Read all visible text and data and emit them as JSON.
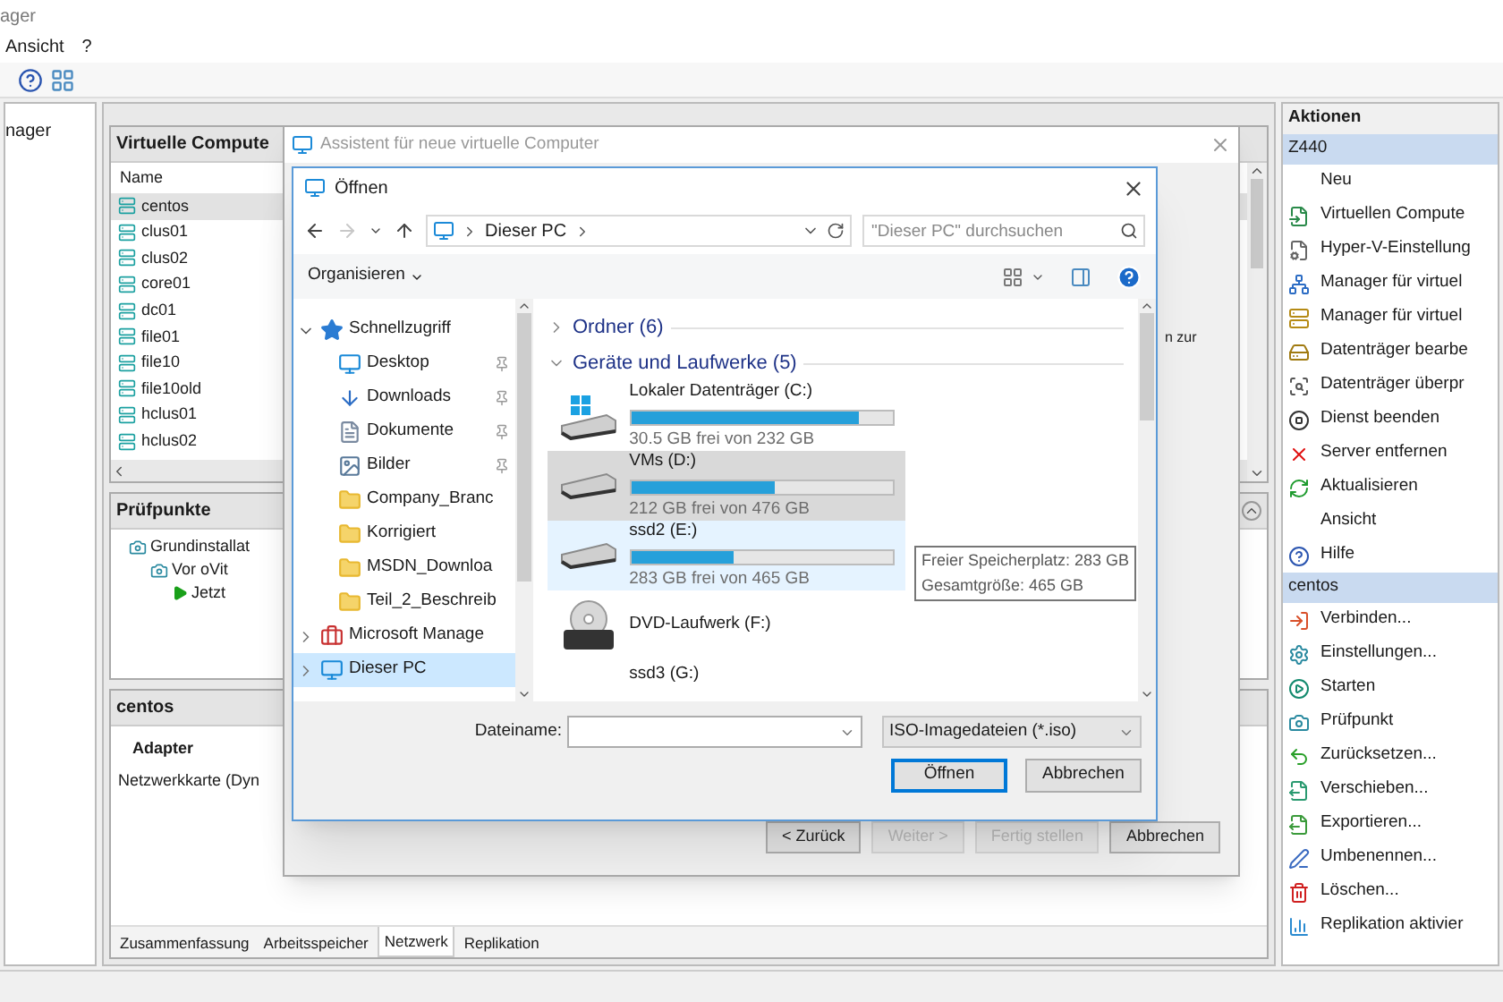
{
  "window": {
    "title": "ager"
  },
  "menu": [
    "Ansicht",
    "?"
  ],
  "left_tree": {
    "label": "nager"
  },
  "vm_panel": {
    "title": "Virtuelle Compute",
    "column": "Name",
    "rows": [
      {
        "name": "centos",
        "selected": true
      },
      {
        "name": "clus01",
        "selected": false
      },
      {
        "name": "clus02",
        "selected": false
      },
      {
        "name": "core01",
        "selected": false
      },
      {
        "name": "dc01",
        "selected": false
      },
      {
        "name": "file01",
        "selected": false
      },
      {
        "name": "file10",
        "selected": false
      },
      {
        "name": "file10old",
        "selected": false
      },
      {
        "name": "hclus01",
        "selected": false
      },
      {
        "name": "hclus02",
        "selected": false
      }
    ]
  },
  "checkpoints": {
    "title": "Prüfpunkte",
    "tree": [
      {
        "label": "Grundinstallat",
        "kind": "checkpoint",
        "children": [
          {
            "label": "Vor oVit",
            "kind": "checkpoint",
            "children": [
              {
                "label": "Jetzt",
                "kind": "current"
              }
            ]
          }
        ]
      }
    ]
  },
  "details": {
    "title": "centos",
    "heading": "Adapter",
    "row": "Netzwerkkarte (Dyn",
    "tabs": [
      {
        "label": "Zusammenfassung",
        "selected": false
      },
      {
        "label": "Arbeitsspeicher",
        "selected": false
      },
      {
        "label": "Netzwerk",
        "selected": true
      },
      {
        "label": "Replikation",
        "selected": false
      }
    ]
  },
  "actions": {
    "title": "Aktionen",
    "groups": [
      {
        "name": "Z440",
        "items": [
          {
            "label": "Neu",
            "kind": "plain"
          },
          {
            "label": "Virtuellen Compute",
            "kind": "import"
          },
          {
            "label": "Hyper-V-Einstellung",
            "kind": "settings-doc"
          },
          {
            "label": "Manager für virtuel",
            "kind": "switch"
          },
          {
            "label": "Manager für virtuel",
            "kind": "san"
          },
          {
            "label": "Datenträger bearbe",
            "kind": "edit-disk"
          },
          {
            "label": "Datenträger überpr",
            "kind": "inspect-disk"
          },
          {
            "label": "Dienst beenden",
            "kind": "stop"
          },
          {
            "label": "Server entfernen",
            "kind": "remove"
          },
          {
            "label": "Aktualisieren",
            "kind": "refresh"
          },
          {
            "label": "Ansicht",
            "kind": "plain"
          },
          {
            "label": "Hilfe",
            "kind": "help"
          }
        ]
      },
      {
        "name": "centos",
        "items": [
          {
            "label": "Verbinden...",
            "kind": "connect"
          },
          {
            "label": "Einstellungen...",
            "kind": "settings"
          },
          {
            "label": "Starten",
            "kind": "start"
          },
          {
            "label": "Prüfpunkt",
            "kind": "checkpoint"
          },
          {
            "label": "Zurücksetzen...",
            "kind": "revert"
          },
          {
            "label": "Verschieben...",
            "kind": "move"
          },
          {
            "label": "Exportieren...",
            "kind": "export"
          },
          {
            "label": "Umbenennen...",
            "kind": "rename"
          },
          {
            "label": "Löschen...",
            "kind": "delete"
          },
          {
            "label": "Replikation aktivier",
            "kind": "replicate"
          }
        ]
      }
    ]
  },
  "wizard": {
    "title": "Assistent für neue virtuelle Computer",
    "text_fragment": "n zur",
    "buttons": [
      {
        "label": "< Zurück",
        "disabled": false
      },
      {
        "label": "Weiter >",
        "disabled": true
      },
      {
        "label": "Fertig stellen",
        "disabled": true
      },
      {
        "label": "Abbrechen",
        "disabled": false
      }
    ]
  },
  "open_dialog": {
    "title": "Öffnen",
    "nav_buttons": [
      {
        "kind": "back",
        "disabled": false
      },
      {
        "kind": "forward",
        "disabled": true
      },
      {
        "kind": "recent",
        "disabled": false
      },
      {
        "kind": "up",
        "disabled": false
      }
    ],
    "address": [
      "Dieser PC"
    ],
    "search": {
      "placeholder": "\"Dieser PC\" durchsuchen"
    },
    "organize": "Organisieren",
    "nav_tree": [
      {
        "label": "Schnellzugriff",
        "kind": "star",
        "expanded": true,
        "selected": false,
        "children": [
          {
            "label": "Desktop",
            "kind": "desktop",
            "pinned": true,
            "selected": false
          },
          {
            "label": "Downloads",
            "kind": "download",
            "pinned": true,
            "selected": false
          },
          {
            "label": "Dokumente",
            "kind": "documents",
            "pinned": true,
            "selected": false
          },
          {
            "label": "Bilder",
            "kind": "pictures",
            "pinned": true,
            "selected": false
          },
          {
            "label": "Company_Branc",
            "kind": "folder",
            "pinned": false,
            "selected": false
          },
          {
            "label": "Korrigiert",
            "kind": "folder",
            "pinned": false,
            "selected": false
          },
          {
            "label": "MSDN_Downloa",
            "kind": "folder",
            "pinned": false,
            "selected": false
          },
          {
            "label": "Teil_2_Beschreib",
            "kind": "folder",
            "pinned": false,
            "selected": false
          }
        ]
      },
      {
        "label": "Microsoft Manage",
        "kind": "toolbox",
        "expanded": false,
        "selected": false
      },
      {
        "label": "Dieser PC",
        "kind": "computer",
        "expanded": false,
        "selected": true
      }
    ],
    "groups": [
      {
        "label": "Ordner (6)",
        "expanded": false
      },
      {
        "label": "Geräte und Laufwerke (5)",
        "expanded": true
      }
    ],
    "drives": [
      {
        "name": "Lokaler Datenträger (C:)",
        "kind": "system",
        "level": 0.87,
        "space": "30.5 GB frei von 232 GB",
        "selected": false,
        "hovered": false
      },
      {
        "name": "VMs (D:)",
        "kind": "disk",
        "level": 0.55,
        "space": "212 GB frei von 476 GB",
        "selected": true,
        "hovered": false
      },
      {
        "name": "ssd2 (E:)",
        "kind": "disk",
        "level": 0.39,
        "space": "283 GB frei von 465 GB",
        "selected": false,
        "hovered": true,
        "tooltip": [
          "Freier Speicherplatz: 283 GB",
          "Gesamtgröße: 465 GB"
        ]
      },
      {
        "name": "DVD-Laufwerk (F:)",
        "kind": "dvd",
        "selected": false,
        "hovered": false
      },
      {
        "name": "ssd3 (G:)",
        "kind": "partial",
        "selected": false,
        "hovered": false
      }
    ],
    "filename_label": "Dateiname:",
    "filter": "ISO-Imagedateien (*.iso)",
    "buttons": [
      {
        "label": "Öffnen",
        "default": true
      },
      {
        "label": "Abbrechen",
        "default": false
      }
    ]
  }
}
